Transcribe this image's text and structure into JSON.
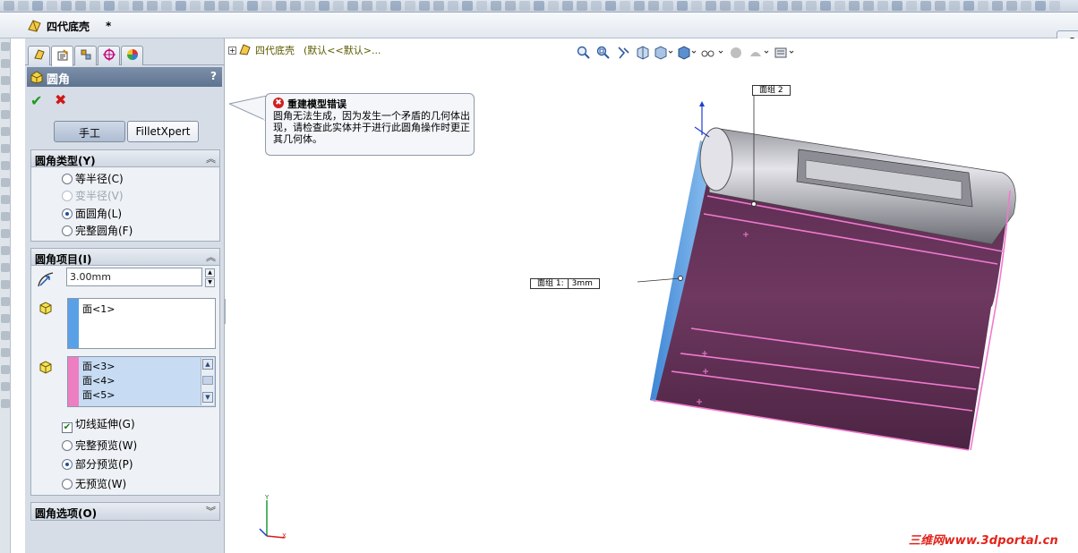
{
  "document": {
    "title": "四代底壳",
    "modified_marker": "*"
  },
  "property_manager": {
    "title": "圆角",
    "help": "?",
    "ok": "✔",
    "cancel": "✖",
    "modes": {
      "manual": "手工",
      "expert": "FilletXpert"
    },
    "fillet_type": {
      "title": "圆角类型(Y)",
      "options": [
        {
          "label": "等半径(C)",
          "selected": false,
          "enabled": true
        },
        {
          "label": "变半径(V)",
          "selected": false,
          "enabled": false
        },
        {
          "label": "面圆角(L)",
          "selected": true,
          "enabled": true
        },
        {
          "label": "完整圆角(F)",
          "selected": false,
          "enabled": true
        }
      ]
    },
    "fillet_items": {
      "title": "圆角项目(I)",
      "radius": "3.00mm",
      "face_set1": [
        "面<1>"
      ],
      "face_set2": [
        "面<3>",
        "面<4>",
        "面<5>"
      ],
      "face_set1_color": "#5aa0e6",
      "face_set2_color": "#ee7ec2",
      "tangent_propagation": {
        "label": "切线延伸(G)",
        "checked": true
      },
      "preview_options": [
        {
          "label": "完整预览(W)",
          "selected": false
        },
        {
          "label": "部分预览(P)",
          "selected": true
        },
        {
          "label": "无预览(W)",
          "selected": false
        }
      ]
    },
    "fillet_options": {
      "title": "圆角选项(O)"
    }
  },
  "viewport": {
    "tree_node": {
      "expander": "+",
      "name": "四代底壳",
      "config": "(默认<<默认>..."
    },
    "error": {
      "title": "重建模型错误",
      "message": "圆角无法生成，因为发生一个矛盾的几何体出现，请检查此实体并于进行此圆角操作时更正其几何体。"
    },
    "callouts": {
      "face_set2": "面组 2",
      "face_set1_label": "面组 1:",
      "face_set1_value": "3mm"
    },
    "triad": {
      "y": "Y",
      "x": "X"
    },
    "watermark": "三维网www.3dportal.cn"
  },
  "right_button": {
    "label": "C"
  },
  "colors": {
    "body_dark": "#4a2440",
    "body_light": "#7a3f6a",
    "highlight_pink": "#f07ad0",
    "highlight_blue": "#5aa0e6",
    "header_blue": "#667a96"
  }
}
